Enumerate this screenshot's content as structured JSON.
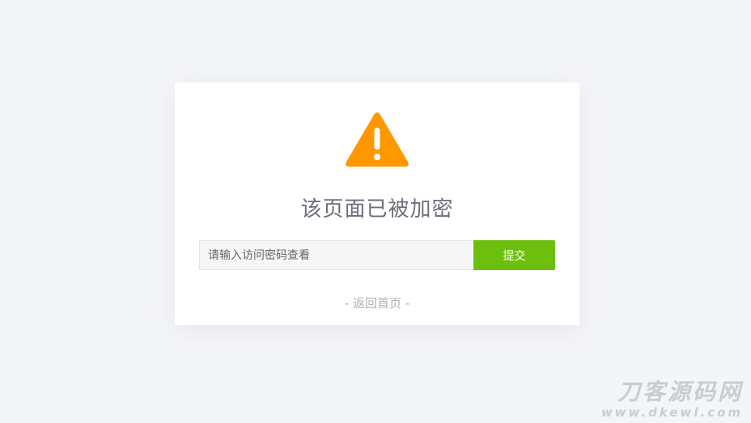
{
  "notice": {
    "icon": "warning-icon",
    "icon_color": "#ff9800",
    "title": "该页面已被加密"
  },
  "form": {
    "password_placeholder": "请输入访问密码查看",
    "password_value": "",
    "submit_label": "提交",
    "submit_color": "#6cc00d"
  },
  "back_link": {
    "label": "- 返回首页 -"
  },
  "watermark": {
    "main": "刀客源码网",
    "sub": "www.dkewl.com"
  }
}
